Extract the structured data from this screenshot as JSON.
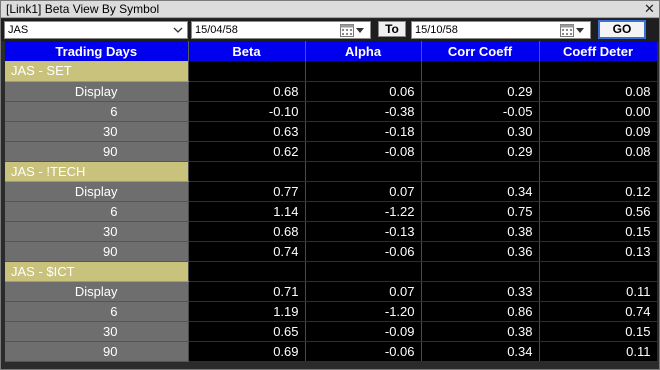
{
  "window": {
    "title": "[Link1] Beta View By Symbol",
    "close_icon": "close-icon"
  },
  "toolbar": {
    "symbol_value": "JAS",
    "from_date": "15/04/58",
    "to_label": "To",
    "to_date": "15/10/58",
    "go_label": "GO"
  },
  "table": {
    "headers": [
      "Trading Days",
      "Beta",
      "Alpha",
      "Corr Coeff",
      "Coeff Deter"
    ],
    "groups": [
      {
        "name": "JAS - SET",
        "rows": [
          {
            "label": "Display",
            "values": [
              "0.68",
              "0.06",
              "0.29",
              "0.08"
            ]
          },
          {
            "label": "6",
            "values": [
              "-0.10",
              "-0.38",
              "-0.05",
              "0.00"
            ]
          },
          {
            "label": "30",
            "values": [
              "0.63",
              "-0.18",
              "0.30",
              "0.09"
            ]
          },
          {
            "label": "90",
            "values": [
              "0.62",
              "-0.08",
              "0.29",
              "0.08"
            ]
          }
        ]
      },
      {
        "name": "JAS - !TECH",
        "rows": [
          {
            "label": "Display",
            "values": [
              "0.77",
              "0.07",
              "0.34",
              "0.12"
            ]
          },
          {
            "label": "6",
            "values": [
              "1.14",
              "-1.22",
              "0.75",
              "0.56"
            ]
          },
          {
            "label": "30",
            "values": [
              "0.68",
              "-0.13",
              "0.38",
              "0.15"
            ]
          },
          {
            "label": "90",
            "values": [
              "0.74",
              "-0.06",
              "0.36",
              "0.13"
            ]
          }
        ]
      },
      {
        "name": "JAS - $ICT",
        "rows": [
          {
            "label": "Display",
            "values": [
              "0.71",
              "0.07",
              "0.33",
              "0.11"
            ]
          },
          {
            "label": "6",
            "values": [
              "1.19",
              "-1.20",
              "0.86",
              "0.74"
            ]
          },
          {
            "label": "30",
            "values": [
              "0.65",
              "-0.09",
              "0.38",
              "0.15"
            ]
          },
          {
            "label": "90",
            "values": [
              "0.69",
              "-0.06",
              "0.34",
              "0.11"
            ]
          }
        ]
      }
    ]
  },
  "colors": {
    "header_bg": "#0000ee",
    "group_bg": "#c9c27c",
    "label_bg": "#6e6e6e",
    "value_bg": "#000000",
    "go_border": "#3a6fd8"
  }
}
